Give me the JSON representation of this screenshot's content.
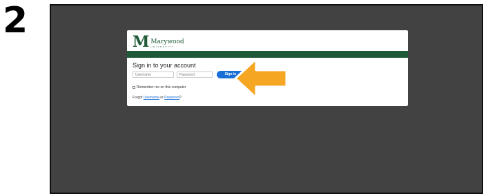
{
  "step": {
    "number": "2"
  },
  "login": {
    "logo": {
      "mark": "M",
      "name": "Marywood",
      "sub": "UNIVERSITY"
    },
    "title": "Sign in to your account",
    "username": {
      "placeholder": "Username"
    },
    "password": {
      "placeholder": "Password"
    },
    "signin_label": "Sign in",
    "remember_label": "Remember me on this computer",
    "forgot": {
      "prefix": "Forgot ",
      "username_link": "Username",
      "middle": " or ",
      "password_link": "Password",
      "suffix": "?"
    }
  },
  "annotation": {
    "arrow_color": "#f5a623",
    "icon": "pointer-arrow-icon"
  },
  "colors": {
    "brand_green": "#1e5a36",
    "accent_blue": "#1a6fd6",
    "screen_bg": "#424242"
  }
}
